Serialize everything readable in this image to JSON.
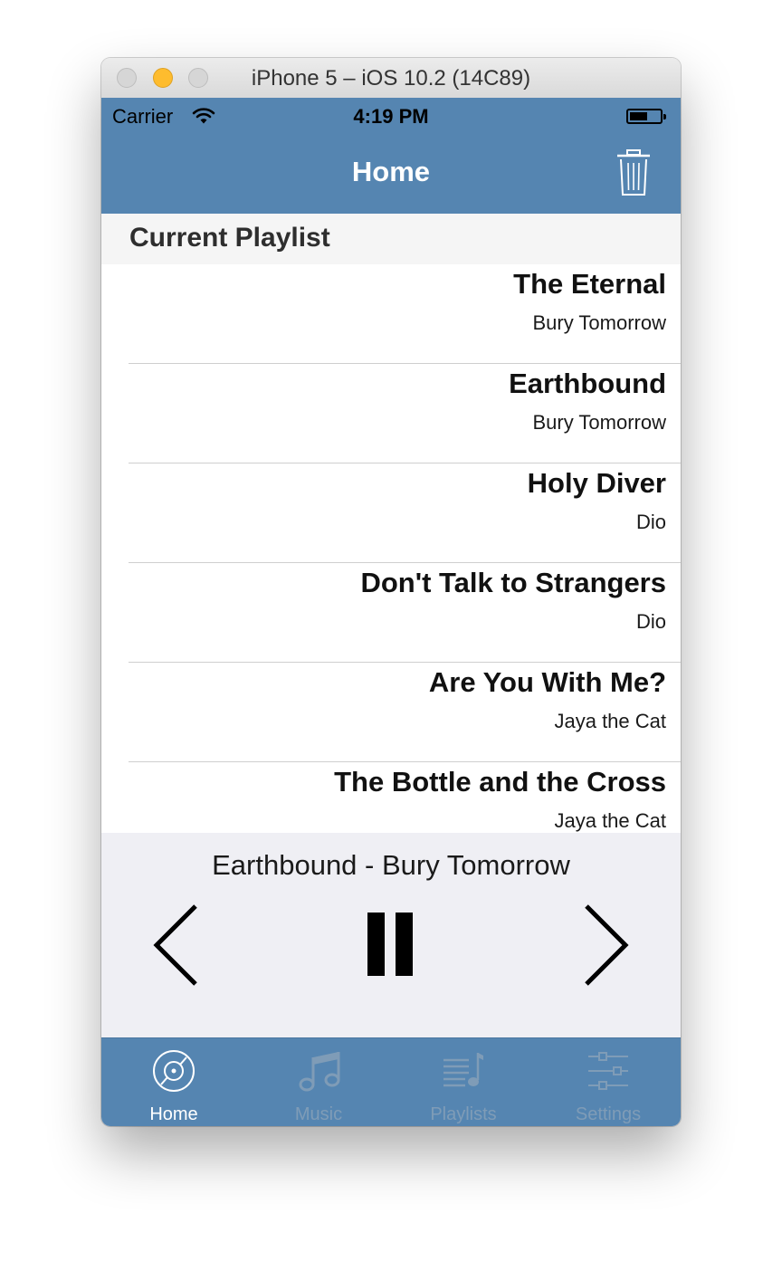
{
  "window": {
    "title": "iPhone 5 – iOS 10.2 (14C89)"
  },
  "status_bar": {
    "carrier": "Carrier",
    "time": "4:19 PM"
  },
  "nav": {
    "title": "Home"
  },
  "playlist": {
    "header": "Current Playlist",
    "songs": [
      {
        "title": "The Eternal",
        "artist": "Bury Tomorrow"
      },
      {
        "title": "Earthbound",
        "artist": "Bury Tomorrow"
      },
      {
        "title": "Holy Diver",
        "artist": "Dio"
      },
      {
        "title": "Don't Talk to Strangers",
        "artist": "Dio"
      },
      {
        "title": "Are You With Me?",
        "artist": "Jaya the Cat"
      },
      {
        "title": "The Bottle and the Cross",
        "artist": "Jaya the Cat"
      }
    ]
  },
  "player": {
    "now_playing": "Earthbound - Bury Tomorrow"
  },
  "tabs": [
    {
      "label": "Home",
      "icon": "disc-icon",
      "active": true
    },
    {
      "label": "Music",
      "icon": "music-note-icon",
      "active": false
    },
    {
      "label": "Playlists",
      "icon": "playlist-icon",
      "active": false
    },
    {
      "label": "Settings",
      "icon": "sliders-icon",
      "active": false
    }
  ],
  "colors": {
    "bar": "#5585b1",
    "player_bg": "#efeff4",
    "inactive_tab": "#7f9cb7"
  }
}
